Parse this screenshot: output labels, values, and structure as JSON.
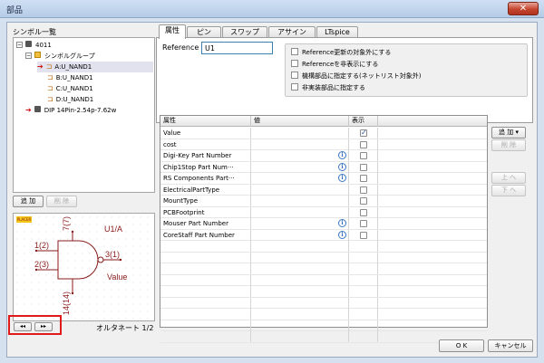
{
  "window": {
    "title": "部品",
    "close": "✕"
  },
  "symbols": {
    "label": "シンボル一覧",
    "tree": [
      {
        "text": "4011"
      },
      {
        "text": "シンボルグループ"
      },
      {
        "text": "A:U_NAND1"
      },
      {
        "text": "B:U_NAND1"
      },
      {
        "text": "C:U_NAND1"
      },
      {
        "text": "D:U_NAND1"
      },
      {
        "text": "DIP 14Pin-2.54p-7.62w"
      }
    ],
    "add_label": "追 加",
    "delete_label": "削 除"
  },
  "preview": {
    "badge": "PLACER",
    "ref_text": "U1/A",
    "value_text": "Value",
    "pins": {
      "p7": "7(7)",
      "p1": "1(2)",
      "p2": "2(3)",
      "p3": "3(1)",
      "p14": "14(14)"
    },
    "nav_prev": "◂◂",
    "nav_next": "▸▸",
    "alternate_label": "オルタネート 1/2"
  },
  "tabs": [
    {
      "label": "属性",
      "active": true
    },
    {
      "label": "ピン"
    },
    {
      "label": "スワップ"
    },
    {
      "label": "アサイン"
    },
    {
      "label": "LTspice"
    }
  ],
  "reference": {
    "label": "Reference",
    "value": "U1"
  },
  "options": [
    {
      "label": "Reference更新の対象外にする"
    },
    {
      "label": "Referenceを非表示にする"
    },
    {
      "label": "機構部品に指定する(ネットリスト対象外)"
    },
    {
      "label": "非実装部品に指定する"
    }
  ],
  "grid": {
    "headers": {
      "name": "属性",
      "value": "値",
      "show": "表示"
    },
    "rows": [
      {
        "name": "Value",
        "info": false,
        "checked": true
      },
      {
        "name": "cost",
        "info": false,
        "checked": false
      },
      {
        "name": "Digi-Key Part Number",
        "info": true,
        "checked": false
      },
      {
        "name": "Chip1Stop Part Num···",
        "info": true,
        "checked": false
      },
      {
        "name": "RS Components Part···",
        "info": true,
        "checked": false
      },
      {
        "name": "ElectricalPartType",
        "info": false,
        "checked": false
      },
      {
        "name": "MountType",
        "info": false,
        "checked": false
      },
      {
        "name": "PCBFootprint",
        "info": false,
        "checked": false
      },
      {
        "name": "Mouser Part Number",
        "info": true,
        "checked": false
      },
      {
        "name": "CoreStaff Part Number",
        "info": true,
        "checked": false
      }
    ]
  },
  "side_buttons": {
    "add": "追 加 ▾",
    "delete": "削 除",
    "up": "上 へ",
    "down": "下 へ"
  },
  "footer": {
    "ok": "O K",
    "cancel": "キャンセル"
  },
  "colors": {
    "accent_red": "#e01a1a",
    "title_bar": "#c3d6ee",
    "schematic": "#8a1a1a"
  }
}
